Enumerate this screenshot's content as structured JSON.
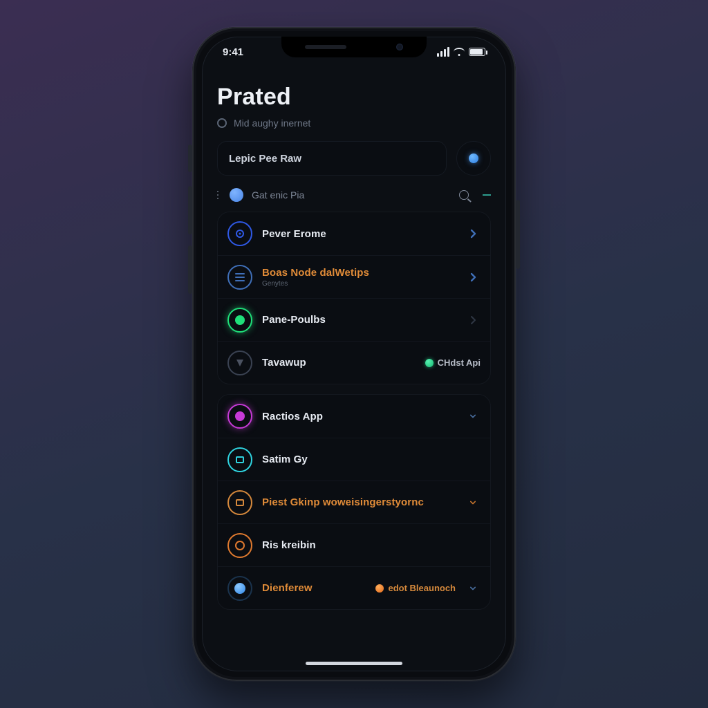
{
  "statusbar": {
    "time": "9:41"
  },
  "header": {
    "title": "Prated",
    "subtitle": "Mid aughy inernet"
  },
  "search": {
    "placeholder": "Lepic Pee Raw"
  },
  "filter": {
    "label": "Gat enic Pia"
  },
  "group1": {
    "items": [
      {
        "label": "Pever Erome",
        "sub": "",
        "color": "#2f59e6",
        "icon": "target",
        "chev": "right",
        "label_orange": false
      },
      {
        "label": "Boas Node dalWetips",
        "sub": "Genytes",
        "color": "#3f6fb8",
        "icon": "bars",
        "chev": "right",
        "label_orange": true
      },
      {
        "label": "Pane-Poulbs",
        "sub": "",
        "color": "#1fe07a",
        "icon": "solid-glow",
        "chev": "dim",
        "label_orange": false
      },
      {
        "label": "Tavawup",
        "sub": "",
        "color": "#2b323e",
        "icon": "tie",
        "badge_label": "CHdst Api",
        "badge_color": "#29d38b",
        "chev": "none",
        "label_orange": false
      }
    ]
  },
  "group2": {
    "items": [
      {
        "label": "Ractios App",
        "sub": "",
        "color": "#c63ad6",
        "icon": "solid-glow-ring",
        "chev": "down-sm",
        "label_orange": false
      },
      {
        "label": "Satim Gy",
        "sub": "",
        "color": "#2fd4e0",
        "icon": "square-ring",
        "chev": "none",
        "label_orange": false
      },
      {
        "label": "Piest Gkinp woweisingerstyornc",
        "sub": "",
        "color": "#d6893c",
        "icon": "square-ring",
        "chev": "down-orange",
        "label_orange": true
      },
      {
        "label": "Ris kreibin",
        "sub": "",
        "color": "#e07a2f",
        "icon": "hollow-ring",
        "chev": "none",
        "label_orange": false
      },
      {
        "label": "Dienferew",
        "sub": "",
        "color": "#4aa7ff",
        "icon": "solid-simple",
        "extra_label": "edot Bleaunoch",
        "chev": "down-sm",
        "label_orange": true
      }
    ]
  }
}
